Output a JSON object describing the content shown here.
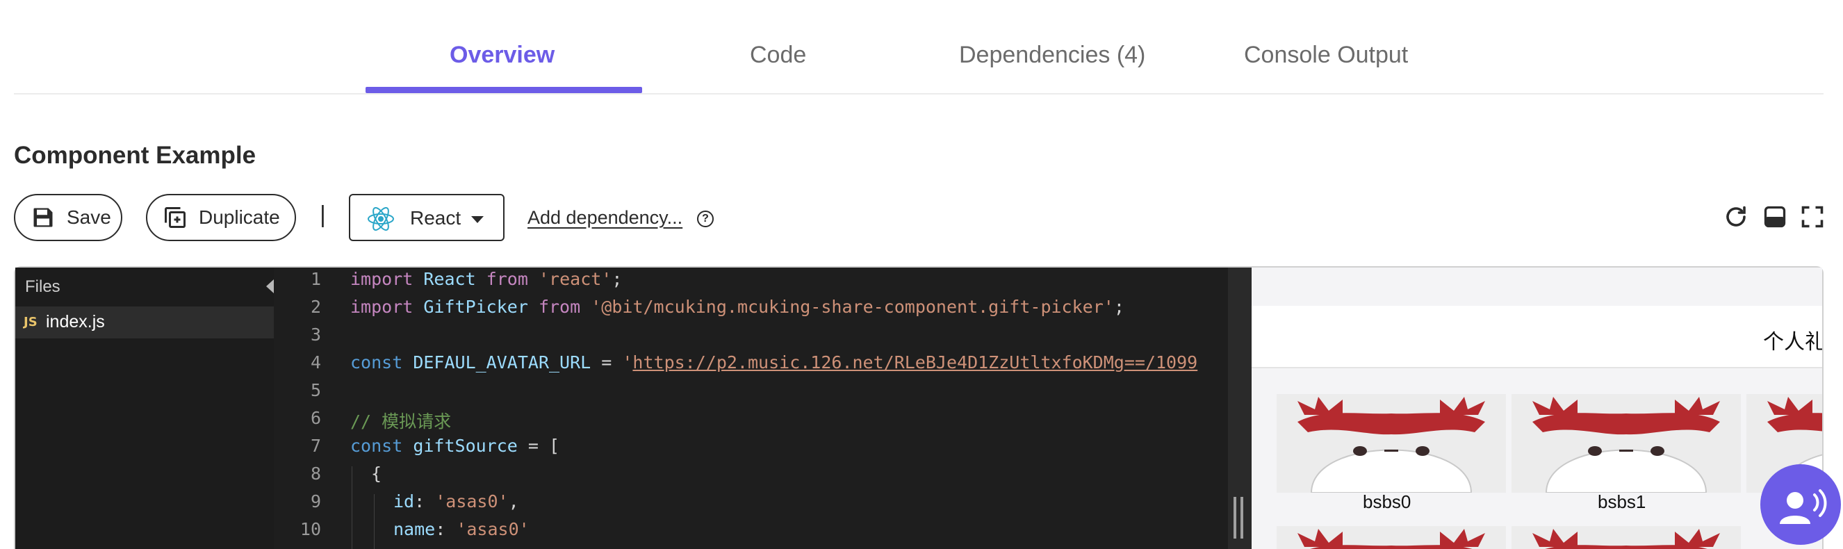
{
  "tabs": [
    {
      "label": "Overview",
      "active": true
    },
    {
      "label": "Code",
      "active": false
    },
    {
      "label": "Dependencies (4)",
      "active": false
    },
    {
      "label": "Console Output",
      "active": false
    }
  ],
  "section_title": "Component Example",
  "toolbar": {
    "save_label": "Save",
    "duplicate_label": "Duplicate",
    "separator": "|",
    "framework": "React",
    "add_dependency": "Add dependency...",
    "help": "?"
  },
  "files": {
    "header": "Files",
    "items": [
      {
        "badge": "JS",
        "name": "index.js"
      }
    ]
  },
  "code_lines": [
    {
      "n": "1"
    },
    {
      "n": "2"
    },
    {
      "n": "3"
    },
    {
      "n": "4"
    },
    {
      "n": "5"
    },
    {
      "n": "6"
    },
    {
      "n": "7"
    },
    {
      "n": "8"
    },
    {
      "n": "9"
    },
    {
      "n": "10"
    }
  ],
  "code_tokens": {
    "import": "import",
    "from": "from",
    "const": "const",
    "react_name": "React",
    "react_str": "'react'",
    "gp_name": "GiftPicker",
    "gp_str": "'@bit/mcuking.mcuking-share-component.gift-picker'",
    "semi": ";",
    "avatar_const": "DEFAUL_AVATAR_URL",
    "eq": " = ",
    "quote": "'",
    "avatar_url": "https://p2.music.126.net/RLeBJe4D1ZzUtltxfoKDMg==/1099",
    "comment": "// 模拟请求",
    "gift_source": "giftSource",
    "open_bracket": " = [",
    "open_brace": "{",
    "id_key": "id",
    "id_val": "'asas0'",
    "name_key": "name",
    "name_val": "'asas0'",
    "colon": ": ",
    "comma": ","
  },
  "preview": {
    "title": "个人礼",
    "gifts": [
      {
        "label": "bsbs0"
      },
      {
        "label": "bsbs1"
      }
    ]
  },
  "colors": {
    "accent": "#6c5ce7",
    "editor_bg": "#1e1e1e",
    "files_bg": "#1c1c1c",
    "antler_red": "#b52a2f"
  },
  "icons": [
    "save-icon",
    "duplicate-icon",
    "react-icon",
    "chevron-down-icon",
    "help-icon",
    "refresh-icon",
    "layout-icon",
    "fullscreen-icon",
    "collapse-icon",
    "chat-icon"
  ]
}
